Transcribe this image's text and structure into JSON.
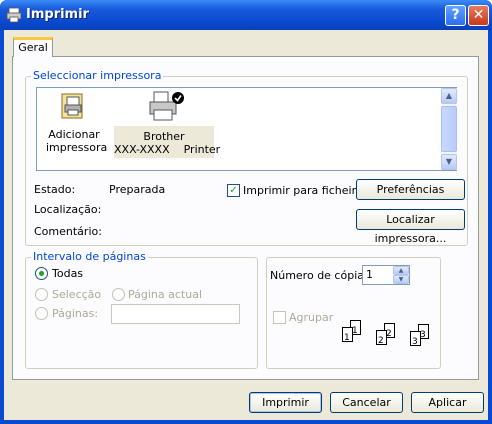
{
  "window": {
    "title": "Imprimir",
    "help_label": "?",
    "close_label": "✕"
  },
  "tabs": [
    {
      "label": "Geral"
    }
  ],
  "select_printer": {
    "group_label": "Seleccionar impressora",
    "printers": [
      {
        "name_line1": "Adicionar",
        "name_line2": "impressora",
        "icon": "add-printer-icon"
      },
      {
        "name_line1": "Brother",
        "name_line2": "XXX-XXXX    Printer",
        "icon": "printer-icon",
        "selected": true
      }
    ],
    "status_label": "Estado:",
    "status_value": "Preparada",
    "location_label": "Localização:",
    "location_value": "",
    "comment_label": "Comentário:",
    "comment_value": "",
    "print_to_file_label": "Imprimir para ficheiro",
    "print_to_file_checked": true,
    "preferences_button": "Preferências",
    "find_printer_button": "Localizar impressora..."
  },
  "page_range": {
    "group_label": "Intervalo de páginas",
    "options": [
      {
        "label": "Todas",
        "selected": true,
        "enabled": true
      },
      {
        "label": "Selecção",
        "selected": false,
        "enabled": false
      },
      {
        "label": "Página actual",
        "selected": false,
        "enabled": false
      },
      {
        "label": "Páginas:",
        "selected": false,
        "enabled": false
      }
    ],
    "pages_value": ""
  },
  "copies": {
    "label": "Número de cópias:",
    "value": "1",
    "collate_label": "Agrupar",
    "collate_checked": false,
    "collate_page_numbers": [
      "1",
      "1",
      "2",
      "2",
      "3",
      "3"
    ]
  },
  "buttons": {
    "print": "Imprimir",
    "cancel": "Cancelar",
    "apply": "Aplicar"
  },
  "colors": {
    "titlebar": "#0a4ad0",
    "group_label": "#0046d5",
    "panel": "#fcfcfe",
    "client": "#ece9d8"
  }
}
